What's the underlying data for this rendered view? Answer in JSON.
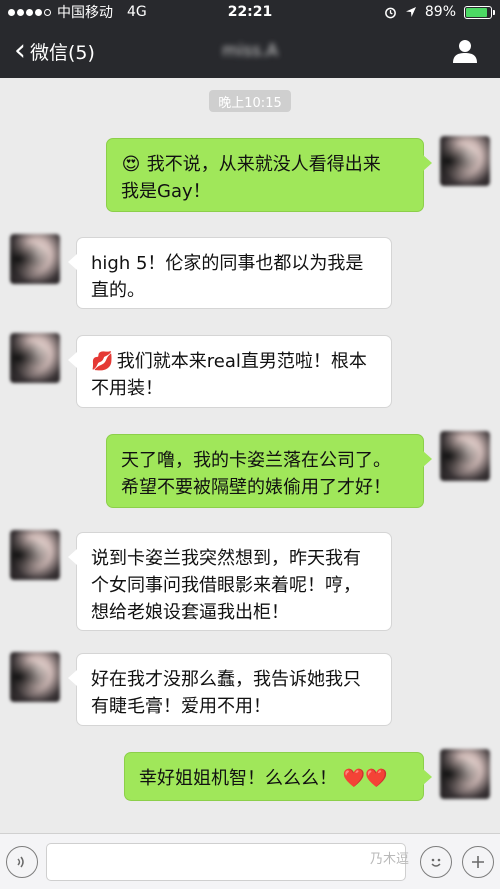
{
  "status_bar": {
    "carrier": "中国移动",
    "network": "4G",
    "time": "22:21",
    "battery": "89%",
    "battery_level": 0.89,
    "signal_bars": 4,
    "icons": [
      "alarm-icon",
      "location-arrow-icon"
    ]
  },
  "nav": {
    "back_label": "微信(5)",
    "title": "miss.A",
    "profile_icon": "person-icon"
  },
  "chat": {
    "timestamp": "晚上10:15",
    "messages": [
      {
        "side": "out",
        "lines": [
          "我不说，从来就没人看得出来",
          "我是Gay！"
        ],
        "emoji": "😍"
      },
      {
        "side": "in",
        "lines": [
          "high 5！伦家的同事也都以为我是",
          "直的。"
        ]
      },
      {
        "side": "in",
        "lines": [
          "我们就本来real直男范啦！根本",
          "不用装！"
        ],
        "emoji": "💋"
      },
      {
        "side": "out",
        "lines": [
          "天了噜，我的卡姿兰落在公司了。",
          "希望不要被隔壁的婊偷用了才好！"
        ]
      },
      {
        "side": "in",
        "lines": [
          "说到卡姿兰我突然想到，昨天我有",
          "个女同事问我借眼影来着呢！哼，",
          "想给老娘设套逼我出柜！"
        ]
      },
      {
        "side": "in",
        "lines": [
          "好在我才没那么蠢，我告诉她我只",
          "有睫毛膏！爱用不用！"
        ]
      },
      {
        "side": "out",
        "lines": [
          "幸好姐姐机智！么么么！"
        ],
        "emoji_after": "❤️❤️"
      }
    ]
  },
  "input_bar": {
    "voice_icon": "voice-icon",
    "emoji_icon": "smiley-icon",
    "plus_icon": "plus-icon",
    "watermark": "乃木逗"
  },
  "colors": {
    "bar_bg": "#28292d",
    "chat_bg": "#ebebeb",
    "out_bubble": "#a0e75a",
    "in_bubble": "#ffffff"
  }
}
